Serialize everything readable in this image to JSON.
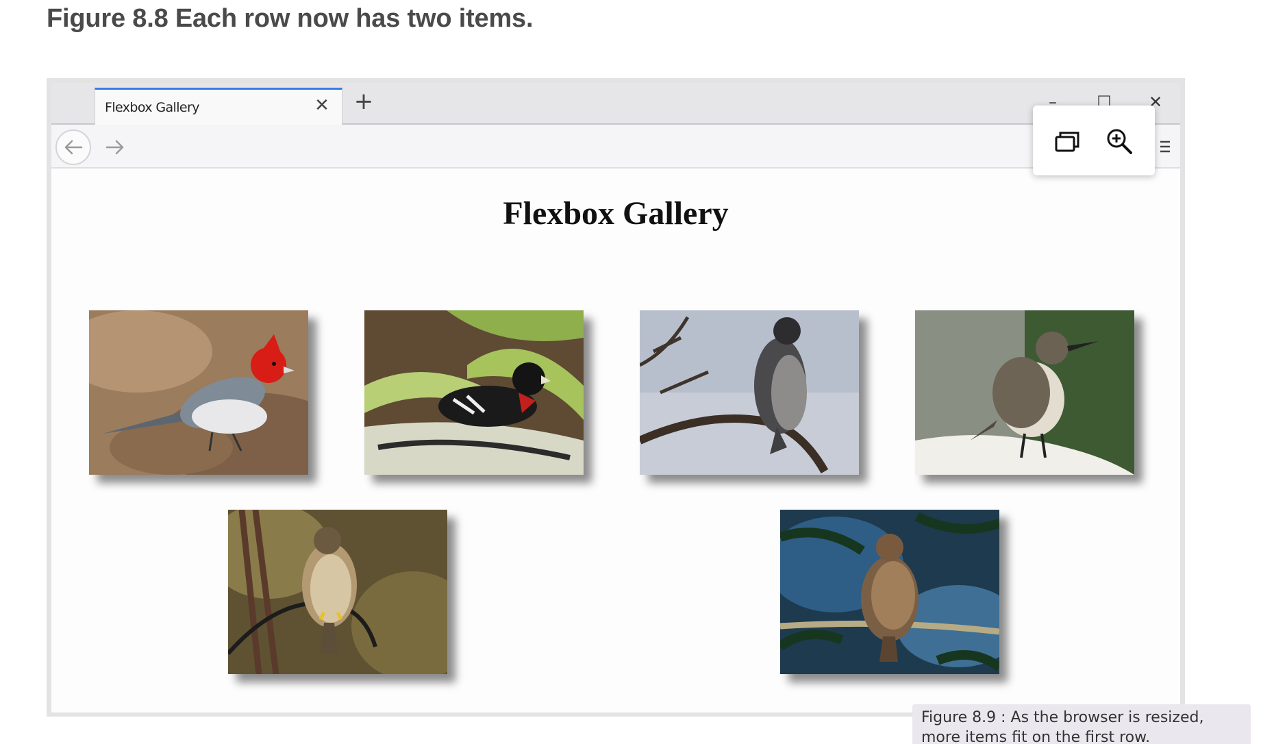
{
  "figure_heading": "Figure 8.8 Each row now has two items.",
  "browser": {
    "tab_title": "Flexbox Gallery",
    "tab_close_glyph": "✕",
    "new_tab_glyph": "+",
    "window_controls": {
      "minimize": "–",
      "maximize": "☐",
      "close": "✕"
    },
    "nav": {
      "back_icon": "arrow-left-icon",
      "forward_icon": "arrow-right-icon",
      "menu_icon": "hamburger-menu-icon"
    },
    "accent_color": "#3b7be6"
  },
  "page": {
    "title": "Flexbox Gallery",
    "photos": [
      {
        "subject": "red-crested-cardinal"
      },
      {
        "subject": "rose-breasted-grosbeak"
      },
      {
        "subject": "falcon-on-branch"
      },
      {
        "subject": "wren-on-snow"
      },
      {
        "subject": "hawk-on-wire"
      },
      {
        "subject": "hawk-in-pine"
      }
    ]
  },
  "floating_toolbar": {
    "buttons": [
      {
        "icon": "open-in-window-icon"
      },
      {
        "icon": "zoom-in-icon"
      }
    ]
  },
  "caption": "Figure 8.9 : As the browser is resized, more items fit on the first row."
}
